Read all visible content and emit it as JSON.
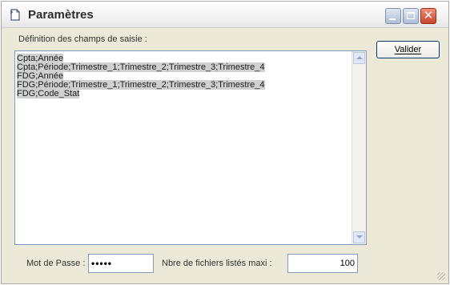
{
  "window": {
    "title": "Paramètres",
    "title_icon": "document-icon"
  },
  "definition": {
    "label": "Définition des champs de saisie :",
    "lines": [
      "Cpta;Année",
      "Cpta;Période;Trimestre_1;Trimestre_2;Trimestre_3;Trimestre_4",
      "FDG;Année",
      "FDG;Période;Trimestre_1;Trimestre_2;Trimestre_3;Trimestre_4",
      "FDG;Code_Stat"
    ]
  },
  "buttons": {
    "valider": "Valider"
  },
  "footer": {
    "password_label": "Mot de Passe :",
    "password_value": "•••••",
    "maxfiles_label": "Nbre de fichiers listés maxi :",
    "maxfiles_value": "100"
  }
}
